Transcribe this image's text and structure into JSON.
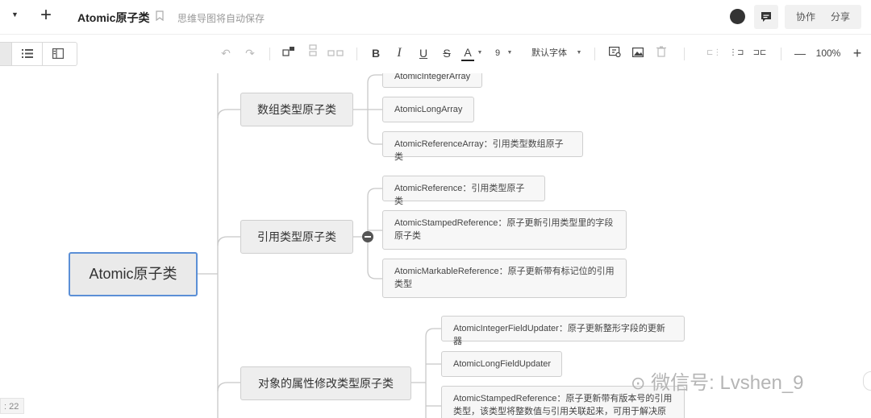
{
  "header": {
    "title": "Atomic原子类",
    "autosave_hint": "思维导图将自动保存",
    "collab_label": "协作",
    "share_label": "分享"
  },
  "toolbar": {
    "bold": "B",
    "italic": "I",
    "underline": "U",
    "strike": "S",
    "font_color": "A",
    "font_size": "9",
    "font_family": "默认字体",
    "zoom": "100%",
    "zoom_out": "—",
    "zoom_in": "+"
  },
  "mindmap": {
    "root": "Atomic原子类",
    "branches": [
      {
        "label": "数组类型原子类",
        "children": [
          "AtomicIntegerArray",
          "AtomicLongArray",
          "AtomicReferenceArray：引用类型数组原子类"
        ]
      },
      {
        "label": "引用类型原子类",
        "children": [
          "AtomicReference：引用类型原子类",
          "AtomicStampedReference：原子更新引用类型里的字段原子类",
          "AtomicMarkableReference：原子更新带有标记位的引用类型"
        ]
      },
      {
        "label": "对象的属性修改类型原子类",
        "children": [
          "AtomicIntegerFieldUpdater：原子更新整形字段的更新器",
          "AtomicLongFieldUpdater",
          "AtomicStampedReference：原子更新带有版本号的引用类型，该类型将整数值与引用关联起来，可用于解决原子"
        ]
      }
    ]
  },
  "watermark": "微信号: Lvshen_9",
  "status": {
    "counter": ": 22"
  },
  "colors": {
    "root_border": "#5b8fd6",
    "line": "#c8c8c8"
  }
}
